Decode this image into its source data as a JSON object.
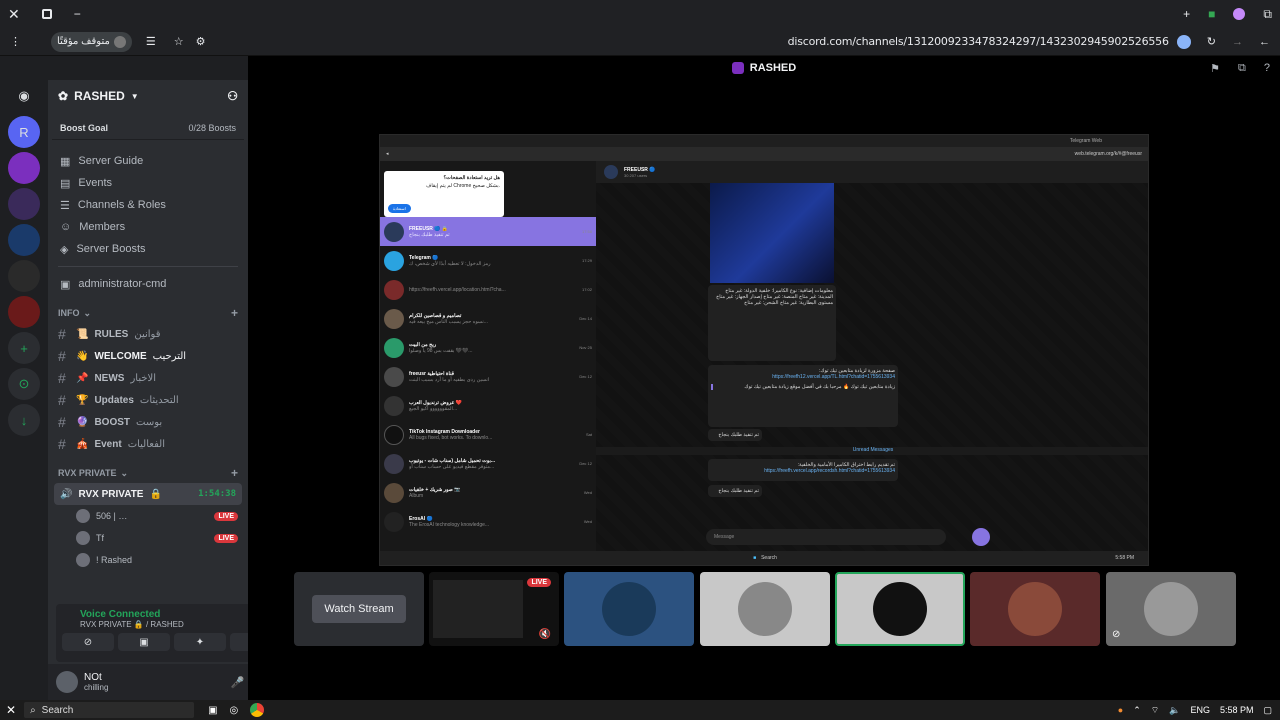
{
  "browser": {
    "profile_label": "متوقف مؤقتًا",
    "url": "discord.com/channels/1312009233478324297/1432302945902526556"
  },
  "stage": {
    "title": "RASHED"
  },
  "server": {
    "name": "RASHED",
    "boost_goal": "Boost Goal",
    "boost_count": "0/28 Boosts",
    "nav": [
      "Server Guide",
      "Events",
      "Channels & Roles",
      "Members",
      "Server Boosts"
    ],
    "admin_channel": "administrator-cmd",
    "categories": {
      "info": "INFO",
      "private": "RVX PRIVATE"
    },
    "info_channels": [
      {
        "name": "RULES",
        "ar": "قوانين",
        "emoji": "📜"
      },
      {
        "name": "WELCOME",
        "ar": "الترحيب",
        "emoji": "👋"
      },
      {
        "name": "NEWS",
        "ar": "الاخبار",
        "emoji": "📌"
      },
      {
        "name": "Updates",
        "ar": "التحديثات",
        "emoji": "🏆"
      },
      {
        "name": "BOOST",
        "ar": "بوست",
        "emoji": "🔮"
      },
      {
        "name": "Event",
        "ar": "الفعاليات",
        "emoji": "🎪"
      }
    ],
    "voice_channel": {
      "name": "RVX PRIVATE",
      "timer": "1:54:38"
    },
    "voice_members": [
      {
        "name": "506 | …",
        "live": "LIVE"
      },
      {
        "name": "Tf",
        "live": "LIVE"
      },
      {
        "name": "! Rashed",
        "live": ""
      }
    ]
  },
  "voice_panel": {
    "status": "Voice Connected",
    "channel": "RVX PRIVATE 🔒 / RASHED"
  },
  "user": {
    "name": "NOt",
    "status": "chilling"
  },
  "shared_screen": {
    "tab_title": "Telegram Web",
    "url": "web.telegram.org/k/#@freeusr",
    "popup_title": "هل تريد استعادة الصفحات؟",
    "popup_text": "لم يتم إيقاف Chrome بشكل صحيح.",
    "popup_button": "استعادة",
    "chat_header": "FREEUSR 🔵",
    "chat_sub": "30 207 users",
    "chats": [
      {
        "title": "FREEUSR 🔵 🔒",
        "sub": "تم تنفيذ طلبك بنجاح",
        "time": "17:58"
      },
      {
        "title": "Telegram 🔵",
        "sub": "رمز الدخول: لا تعطيه أبدًا لأي شخص، ك",
        "time": "17:29"
      },
      {
        "title": "",
        "sub": "https://freefh.vercel.app/location.html?cha...",
        "time": "17:02"
      },
      {
        "title": "تصاميم و قصاصين للكرام",
        "sub": "نسوه حجز يسبب الناس ميح بيعه فيه...",
        "time": "Dec 14"
      },
      {
        "title": "ربح من البيت",
        "sub": "بقفت بس 98 يا وصلوا 🖤🖤...",
        "time": "Nov 25"
      },
      {
        "title": "freeusr قناة احتياطية",
        "sub": "انسين ردى بطفيه أو ما أرد بسبب البنت",
        "time": "Dec 12"
      },
      {
        "title": "عروض ترنديول العرب ❤️",
        "sub": "المقوووووو اكيو الجيع...",
        "time": ""
      },
      {
        "title": "TikTok Instagram Downloader",
        "sub": "All bugs fixed, bot works. To downlo...",
        "time": "Sat"
      },
      {
        "title": "بوت تحميل شامل (سناب شات - يوتيوب...",
        "sub": "متوفر مقطع فيديو على حساب سناب أو...",
        "time": "Dec 12"
      },
      {
        "title": "صور شريك + خلفيات 📷",
        "sub": "Album",
        "time": "Wed"
      },
      {
        "title": "ErosAI 🔵",
        "sub": "The ErosAI technology knowledge...",
        "time": "Wed"
      }
    ],
    "messages": {
      "info_block": "معلومات إضافية: نوع الكاميرا: خلفية الدولة: غير متاح المدينة: غير متاح المنصة: غير متاح إصدار الجهاز: غير متاح مستوى البطارية: غير متاح الشحن: غير متاح",
      "link_msg_title": "صفحة مزورة لزيادة متابعين تيك توك:",
      "link_msg_url": "https://freefh12.vercel.app/TL.html?chatid=1755613934",
      "promo_text": "زيادة متابعين تيك توك 🔥 مرحبا بك في أفضل موقع زيادة متابعين تيك توك",
      "done_text": "تم تنفيذ طلبك بنجاح",
      "unread": "Unread Messages",
      "record_title": "تم تقديم رابط اختراق الكاميرا الأمامية والخلفية:",
      "record_url": "https://freefh.vercel.app/recordsh.html?chatid=1755613934",
      "done_text_2": "تم تنفيذ طلبك بنجاح"
    },
    "input_placeholder": "Message",
    "taskbar_search": "Search",
    "clock": "5:58 PM"
  },
  "tiles": {
    "watch_stream": "Watch Stream",
    "live_badge": "LIVE"
  },
  "taskbar": {
    "search": "Search",
    "lang": "ENG",
    "time": "5:58 PM"
  },
  "colors": {
    "accent": "#5865f2",
    "green": "#23a55a",
    "live_red": "#da373c",
    "telegram_purple": "#8774e1"
  }
}
